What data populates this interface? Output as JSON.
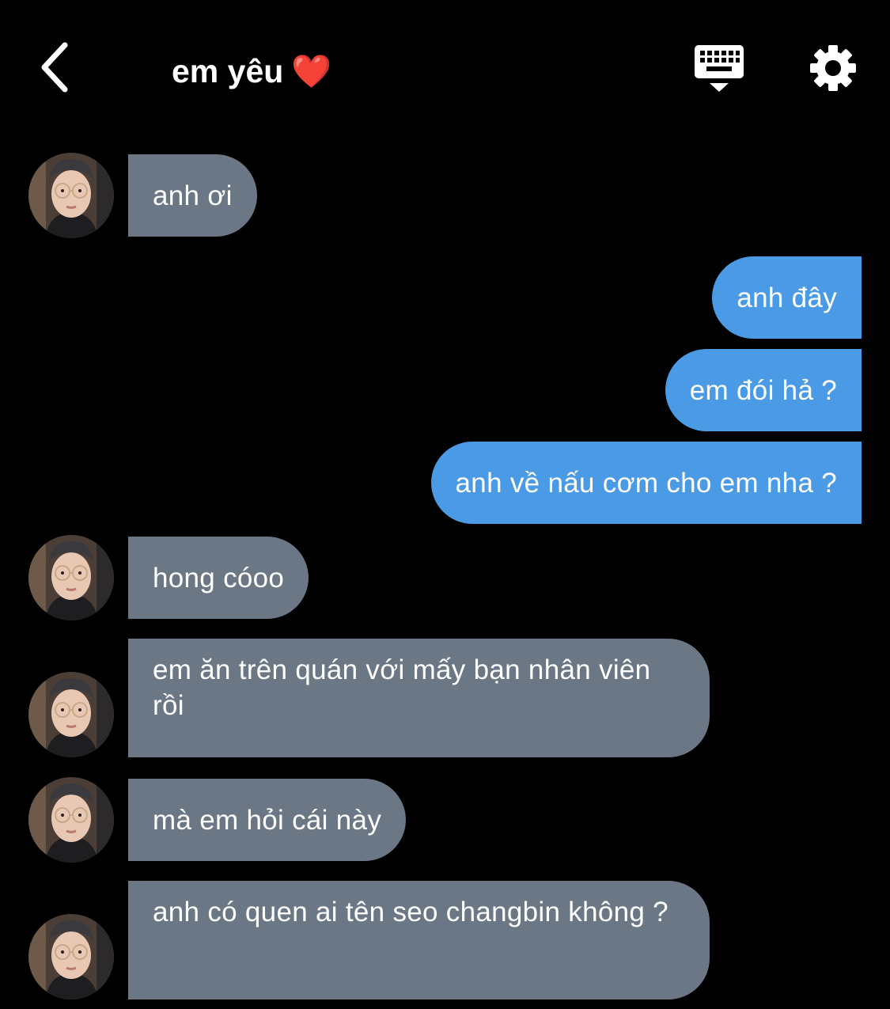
{
  "header": {
    "title": "em yêu",
    "title_emoji": "❤️",
    "back_icon": "chevron-left-icon",
    "keyboard_icon": "keyboard-hide-icon",
    "settings_icon": "gear-icon"
  },
  "colors": {
    "background": "#000000",
    "incoming_bubble": "#6b7785",
    "outgoing_bubble": "#4a9ae5",
    "text": "#ffffff"
  },
  "messages": [
    {
      "sender": "them",
      "text": "anh ơi"
    },
    {
      "sender": "me",
      "text": "anh đây"
    },
    {
      "sender": "me",
      "text": "em đói hả ?"
    },
    {
      "sender": "me",
      "text": "anh về nấu cơm cho em nha ?"
    },
    {
      "sender": "them",
      "text": "hong cóoo"
    },
    {
      "sender": "them",
      "text": "em ăn trên quán với mấy bạn nhân viên rồi"
    },
    {
      "sender": "them",
      "text": "mà em hỏi cái này"
    },
    {
      "sender": "them",
      "text": "anh có quen ai tên seo changbin không ?"
    }
  ]
}
